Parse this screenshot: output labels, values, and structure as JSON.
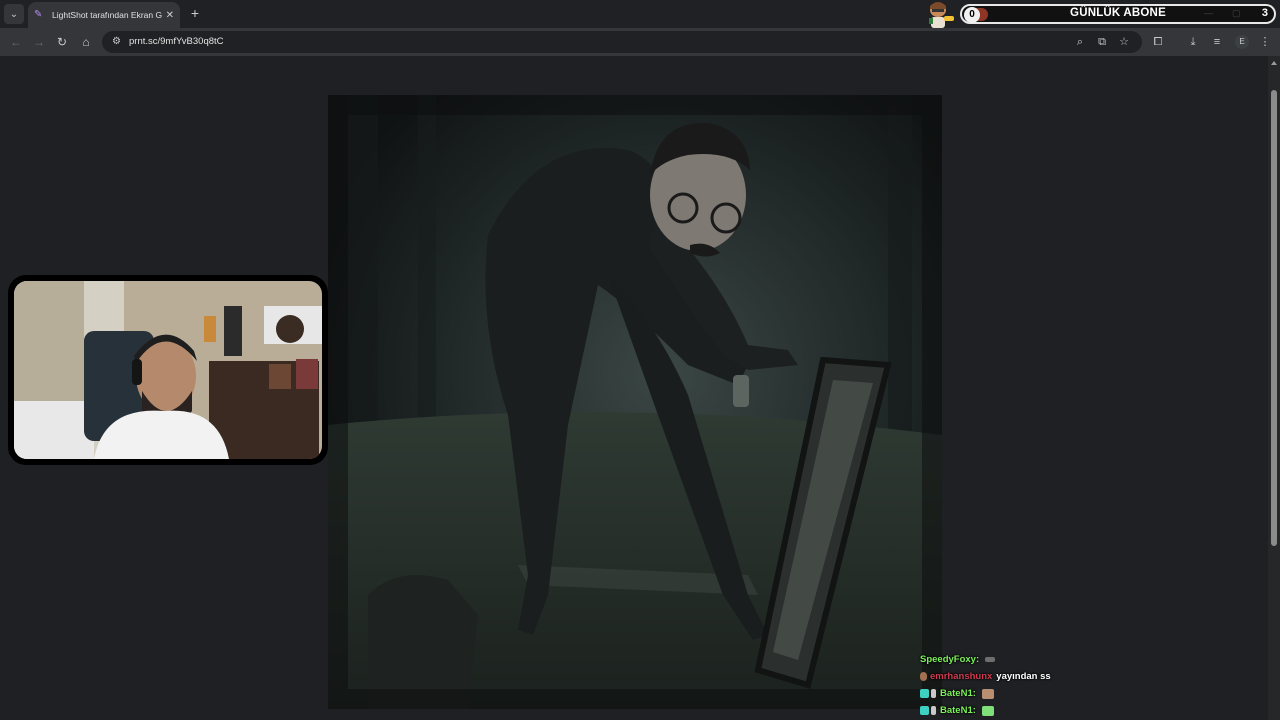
{
  "browser": {
    "tab": {
      "title": "LightShot tarafından Ekran Görüntüsü"
    },
    "address_bar": {
      "url": "prnt.sc/9mfYvB30q8tC"
    },
    "profile_initial": "E"
  },
  "stream_overlay": {
    "subscriber_widget": {
      "title": "GÜNLÜK ABONE",
      "current": "0",
      "goal": "3",
      "progress_fraction": 0
    },
    "chat": [
      {
        "user": "SpeedyFoxy:",
        "user_color": "#7cf05a",
        "message": "",
        "emote": "gun-emote"
      },
      {
        "user": "emrhanshunx",
        "user_color": "#d03a4f",
        "message": "yayından ss",
        "emote": ""
      },
      {
        "user": "BateN1:",
        "user_color": "#7cf05a",
        "message": "",
        "emote": "face-emote"
      },
      {
        "user": "BateN1:",
        "user_color": "#7cf05a",
        "message": "",
        "emote": "qr-emote"
      }
    ]
  },
  "colors": {
    "browser_frame": "#202124",
    "toolbar": "#35363a",
    "page_background": "#1e2023",
    "widget_accent": "#8d3626"
  }
}
